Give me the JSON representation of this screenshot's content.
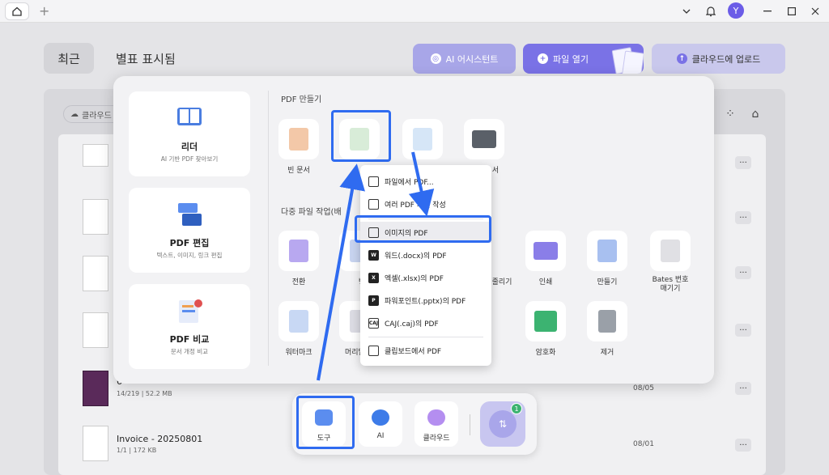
{
  "titlebar": {
    "avatar_initial": "Y"
  },
  "header": {
    "recent_tab": "최근",
    "starred_tab": "별표 표시됨",
    "ai_button": "AI 어시스턴트",
    "open_button": "파일 열기",
    "upload_button": "클라우드에 업로드"
  },
  "list": {
    "cloud_filter": "클라우드",
    "rows": [
      {
        "title": "",
        "sub": "",
        "date": ""
      },
      {
        "title": "",
        "sub": "",
        "date": ""
      },
      {
        "title": "",
        "sub": "",
        "date": ""
      },
      {
        "title": "",
        "sub": "",
        "date": ""
      },
      {
        "title": "6",
        "sub": "14/219 | 52.2 MB",
        "date": "08/05"
      },
      {
        "title": "Invoice - 20250801",
        "sub": "1/1 | 172 KB",
        "date": "08/01"
      }
    ]
  },
  "popup": {
    "cards": [
      {
        "title": "리더",
        "sub": "AI 기반 PDF 찾아보기"
      },
      {
        "title": "PDF 편집",
        "sub": "텍스트, 이미지, 링크 편집"
      },
      {
        "title": "PDF 비교",
        "sub": "문서 개정 비교"
      }
    ],
    "create_section": "PDF 만들기",
    "batch_section": "다중 파일 작업(배",
    "create_tools": [
      "빈 문서",
      "",
      "",
      ""
    ],
    "create_tool_partial": "서",
    "batch_tools": [
      "전환",
      "병",
      "줄리기",
      "인쇄",
      "만들기",
      "Bates 번호\n매기기"
    ],
    "batch_tools_row2": [
      "워터마크",
      "머리말 및",
      "",
      "암호화",
      "제거"
    ]
  },
  "menu": {
    "items": [
      "파일에서 PDF...",
      "여러 PDF 파일 작성",
      "이미지의 PDF",
      "워드(.docx)의 PDF",
      "엑셀(.xlsx)의 PDF",
      "파워포인트(.pptx)의 PDF",
      "CAJ(.caj)의 PDF",
      "클립보드에서 PDF"
    ]
  },
  "dock": {
    "tools": "도구",
    "ai": "AI",
    "cloud": "클라우드",
    "badge_count": "1"
  },
  "colors": {
    "accent": "#7a72e6",
    "highlight": "#2f6bf0",
    "badge": "#3cb371"
  }
}
